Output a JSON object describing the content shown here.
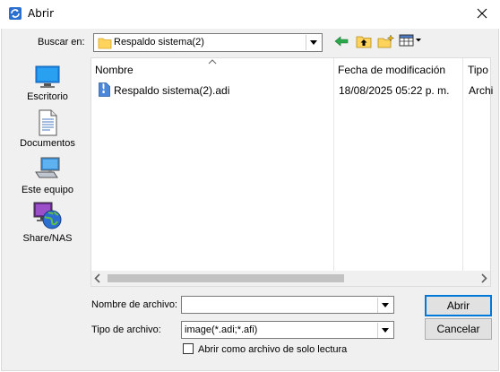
{
  "window": {
    "title": "Abrir",
    "close_icon": "close-icon"
  },
  "lookin": {
    "label": "Buscar en:",
    "value": "Respaldo sistema(2)"
  },
  "toolbar": {
    "icons": [
      "back-arrow-icon",
      "up-folder-icon",
      "new-folder-icon",
      "view-menu-icon"
    ]
  },
  "places": [
    {
      "label": "Escritorio",
      "icon": "desktop-icon"
    },
    {
      "label": "Documentos",
      "icon": "documents-icon"
    },
    {
      "label": "Este equipo",
      "icon": "computer-icon"
    },
    {
      "label": "Share/NAS",
      "icon": "network-globe-icon"
    }
  ],
  "filelist": {
    "columns": [
      "Nombre",
      "Fecha de modificación",
      "Tipo"
    ],
    "rows": [
      {
        "name": "Respaldo sistema(2).adi",
        "date": "18/08/2025 05:22 p. m.",
        "type": "Archi"
      }
    ]
  },
  "form": {
    "filename_label": "Nombre de archivo:",
    "filename_value": "",
    "filetype_label": "Tipo de archivo:",
    "filetype_value": "image(*.adi;*.afi)",
    "readonly_label": "Abrir como archivo de solo lectura",
    "readonly_checked": false
  },
  "buttons": {
    "open": "Abrir",
    "cancel": "Cancelar"
  },
  "colors": {
    "accent": "#0078d7",
    "folder": "#ffd35c",
    "arrow_green": "#2aa84a"
  }
}
